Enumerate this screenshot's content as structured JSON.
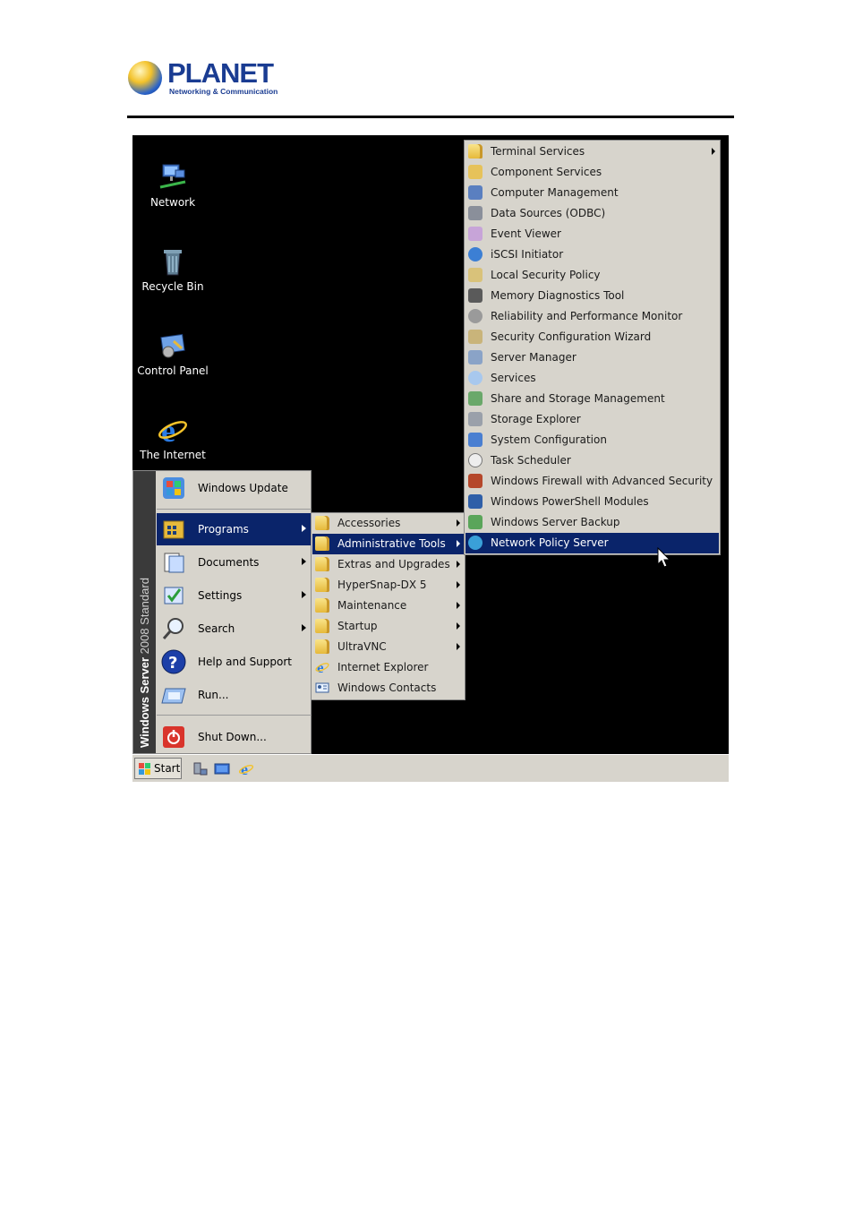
{
  "brand": {
    "name": "PLANET",
    "tagline": "Networking & Communication",
    "primary_color": "#1a3c92"
  },
  "desktop": {
    "icons": [
      {
        "label": "Network",
        "icon": "network-icon"
      },
      {
        "label": "Recycle Bin",
        "icon": "recycle-bin-icon"
      },
      {
        "label": "Control Panel",
        "icon": "control-panel-icon"
      },
      {
        "label": "The Internet",
        "icon": "internet-explorer-icon"
      }
    ]
  },
  "start_menu": {
    "banner_bold": "Windows Server",
    "banner_rest": " 2008 Standard",
    "items": [
      {
        "label": "Windows Update",
        "icon": "windows-update-icon",
        "has_submenu": false
      },
      {
        "label": "Programs",
        "icon": "programs-icon",
        "has_submenu": true,
        "selected": true
      },
      {
        "label": "Documents",
        "icon": "documents-icon",
        "has_submenu": true
      },
      {
        "label": "Settings",
        "icon": "settings-icon",
        "has_submenu": true
      },
      {
        "label": "Search",
        "icon": "search-icon",
        "has_submenu": true
      },
      {
        "label": "Help and Support",
        "icon": "help-icon",
        "has_submenu": false
      },
      {
        "label": "Run...",
        "icon": "run-icon",
        "has_submenu": false
      },
      {
        "label": "Shut Down...",
        "icon": "shutdown-icon",
        "has_submenu": false
      }
    ]
  },
  "programs_menu": {
    "items": [
      {
        "label": "Accessories",
        "has_submenu": true
      },
      {
        "label": "Administrative Tools",
        "has_submenu": true,
        "selected": true
      },
      {
        "label": "Extras and Upgrades",
        "has_submenu": true
      },
      {
        "label": "HyperSnap-DX 5",
        "has_submenu": true
      },
      {
        "label": "Maintenance",
        "has_submenu": true
      },
      {
        "label": "Startup",
        "has_submenu": true
      },
      {
        "label": "UltraVNC",
        "has_submenu": true
      },
      {
        "label": "Internet Explorer",
        "has_submenu": false
      },
      {
        "label": "Windows Contacts",
        "has_submenu": false
      }
    ]
  },
  "admin_tools_menu": {
    "items": [
      {
        "label": "Terminal Services",
        "has_submenu": true
      },
      {
        "label": "Component Services"
      },
      {
        "label": "Computer Management"
      },
      {
        "label": "Data Sources (ODBC)"
      },
      {
        "label": "Event Viewer"
      },
      {
        "label": "iSCSI Initiator"
      },
      {
        "label": "Local Security Policy"
      },
      {
        "label": "Memory Diagnostics Tool"
      },
      {
        "label": "Reliability and Performance Monitor"
      },
      {
        "label": "Security Configuration Wizard"
      },
      {
        "label": "Server Manager"
      },
      {
        "label": "Services"
      },
      {
        "label": "Share and Storage Management"
      },
      {
        "label": "Storage Explorer"
      },
      {
        "label": "System Configuration"
      },
      {
        "label": "Task Scheduler"
      },
      {
        "label": "Windows Firewall with Advanced Security"
      },
      {
        "label": "Windows PowerShell Modules"
      },
      {
        "label": "Windows Server Backup"
      },
      {
        "label": "Network Policy Server",
        "selected": true
      }
    ]
  },
  "taskbar": {
    "start_label": "Start",
    "quick_launch": [
      "server-manager-icon",
      "show-desktop-icon",
      "internet-explorer-icon"
    ]
  },
  "colors": {
    "menu_bg": "#d7d4cc",
    "selection": "#0a246a",
    "desktop_bg": "#000000"
  }
}
